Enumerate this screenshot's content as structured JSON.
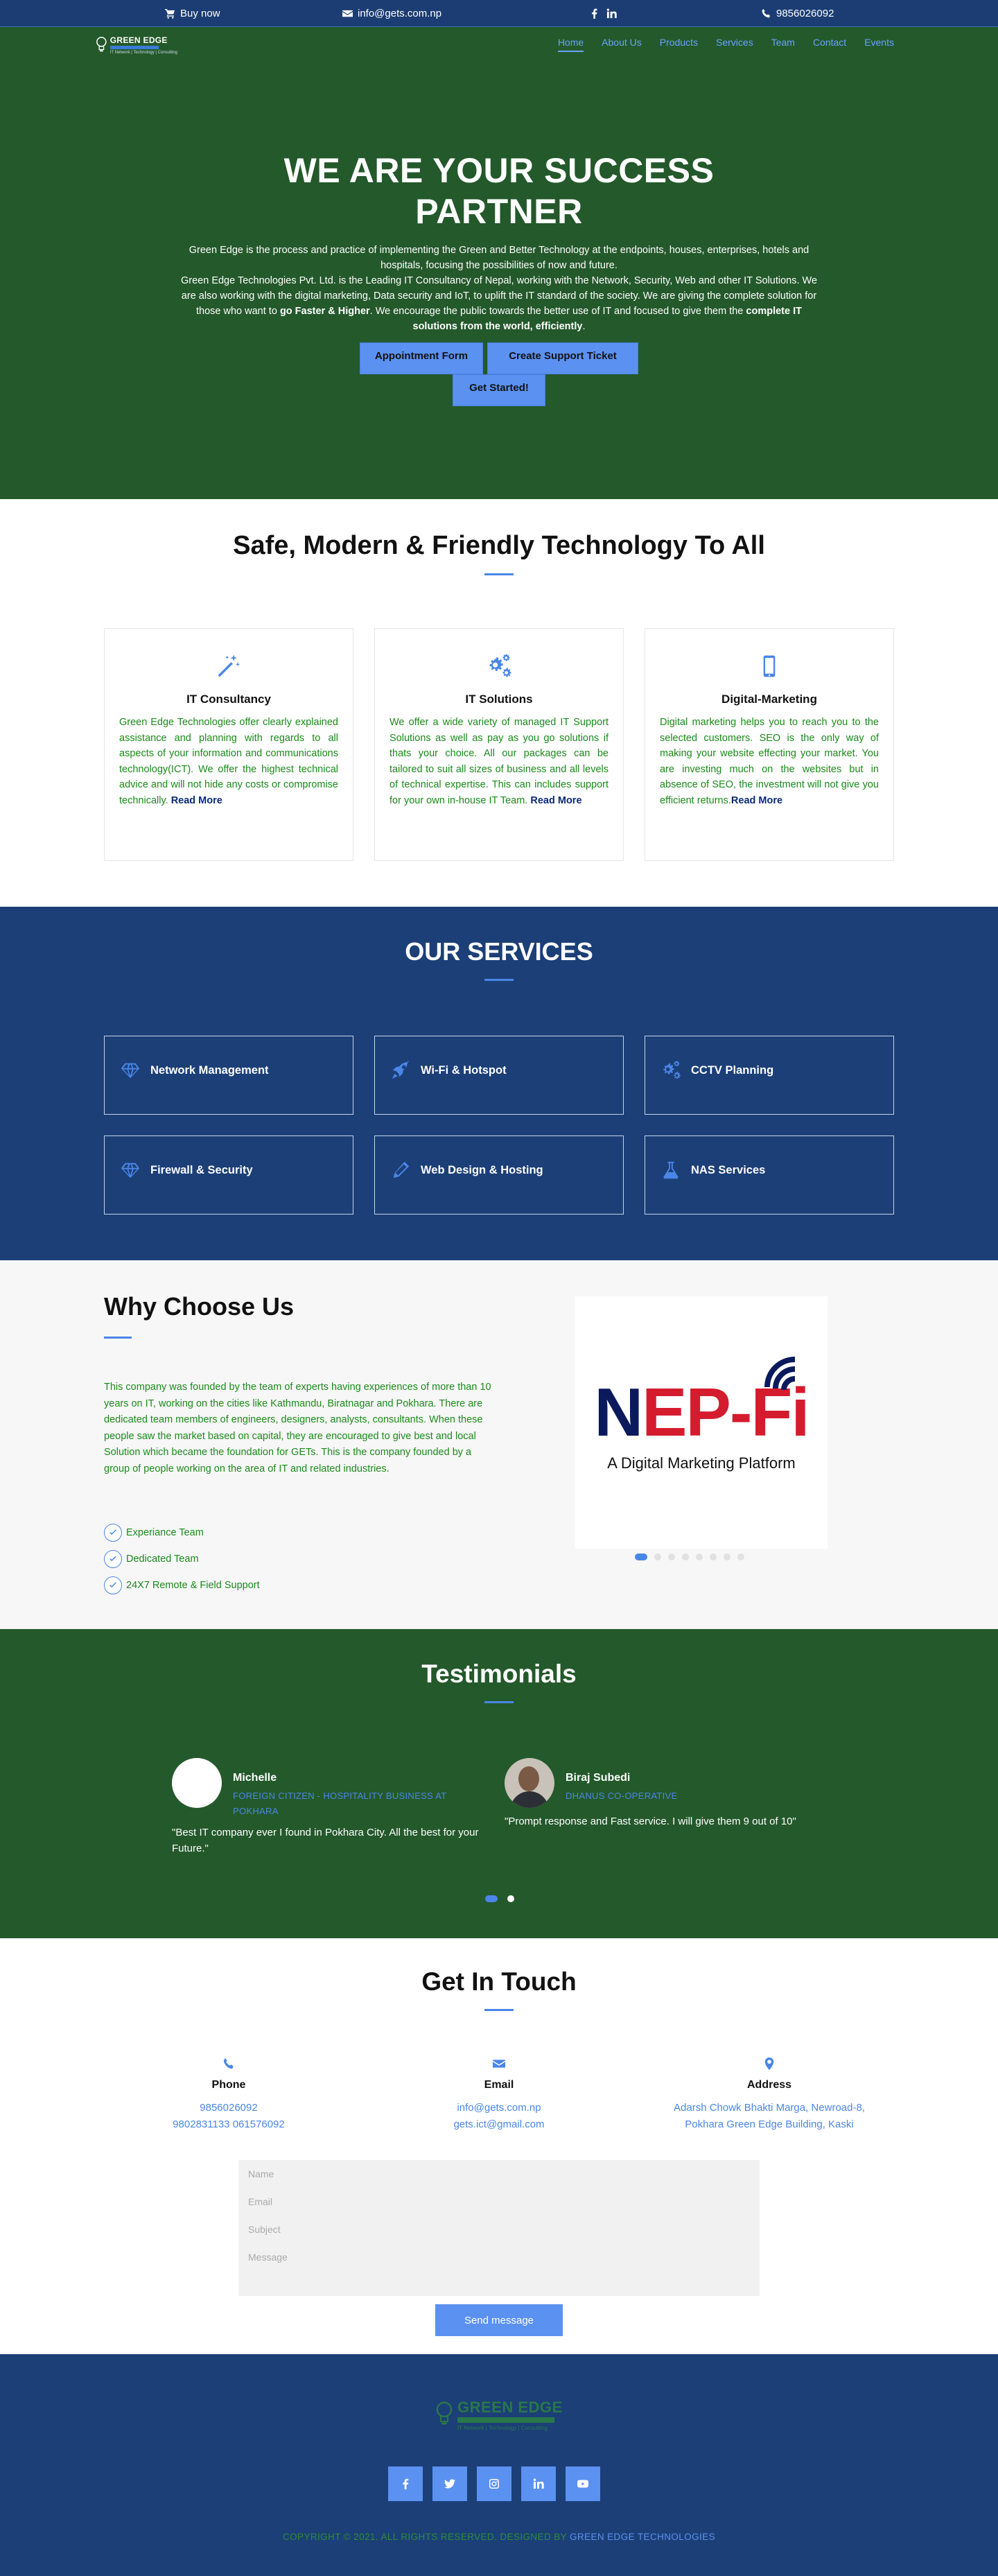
{
  "topbar": {
    "buy": "Buy now",
    "email": "info@gets.com.np",
    "phone": "9856026092"
  },
  "logo": {
    "name": "GREEN EDGE",
    "sub": "IT Network | Technology | Consulting"
  },
  "nav": {
    "items": [
      "Home",
      "About Us",
      "Products",
      "Services",
      "Team",
      "Contact",
      "Events"
    ]
  },
  "hero": {
    "title": "WE ARE YOUR SUCCESS PARTNER",
    "p1": "Green Edge is the process and practice of implementing the Green and Better Technology at the endpoints, houses, enterprises, hotels and hospitals, focusing the possibilities of now and future.",
    "p2a": "Green Edge Technologies Pvt. Ltd. is the Leading IT Consultancy of Nepal, working with the Network, Security, Web and other IT Solutions. We are also working with the digital marketing, Data security and IoT, to uplift the IT standard of the society. We are giving the complete solution for those who want to ",
    "p2b": "go Faster & Higher",
    "p2c": ". We encourage the public towards the better use of IT and focused to give them the ",
    "p2d": "complete IT solutions from the world, efficiently",
    "p2e": ".",
    "btn_appointment": "Appointment Form",
    "btn_support": "Create Support Ticket",
    "btn_start": "Get Started!"
  },
  "safe": {
    "title": "Safe, Modern & Friendly Technology To All",
    "cards": [
      {
        "icon": "magic-wand-icon",
        "title": "IT Consultancy",
        "text": "Green Edge Technologies offer clearly explained assistance and planning with regards to all aspects of your information and communications technology(ICT). We offer the highest technical advice and will not hide any costs or compromise technically. ",
        "more": "Read More"
      },
      {
        "icon": "gears-icon",
        "title": "IT Solutions",
        "text": "We offer a wide variety of managed IT Support Solutions as well as pay as you go solutions if thats your choice. All our packages can be tailored to suit all sizes of business and all levels of technical expertise. This can includes support for your own in-house IT Team. ",
        "more": "Read More"
      },
      {
        "icon": "mobile-icon",
        "title": "Digital-Marketing",
        "text": "Digital marketing helps you to reach you to the selected customers. SEO is the only way of making your website effecting your market. You are investing much on the websites but in absence of SEO, the investment will not give you efficient returns.",
        "more": "Read More"
      }
    ]
  },
  "services": {
    "title": "OUR SERVICES",
    "items": [
      {
        "label": "Network Management",
        "icon": "diamond-icon"
      },
      {
        "label": "Wi-Fi & Hotspot",
        "icon": "rocket-icon"
      },
      {
        "label": "CCTV Planning",
        "icon": "gears-icon"
      },
      {
        "label": "Firewall & Security",
        "icon": "diamond-icon"
      },
      {
        "label": "Web Design & Hosting",
        "icon": "pencil-icon"
      },
      {
        "label": "NAS Services",
        "icon": "flask-icon"
      }
    ]
  },
  "why": {
    "title": "Why Choose Us",
    "text": "This company was founded by the team of experts having experiences of more than 10 years on IT, working on the cities like Kathmandu, Biratnagar and Pokhara. There are dedicated team members of engineers, designers, analysts, consultants. When these people saw the market based on capital, they are encouraged to give best and local Solution which became the foundation for GETs. This is the company founded by a group of people working on the area of IT and related industries.",
    "points": [
      "Experiance Team",
      "Dedicated Team",
      "24X7 Remote & Field Support"
    ],
    "slide_logo_a": "N",
    "slide_logo_b": "E",
    "slide_logo_c": "P-Fi",
    "slide_caption": "A Digital Marketing Platform"
  },
  "testimonials": {
    "title": "Testimonials",
    "items": [
      {
        "name": "Michelle",
        "role": "FOREIGN CITIZEN - HOSPITALITY BUSINESS AT POKHARA",
        "quote": "\"Best IT company ever I found in Pokhara City. All the best for your Future.\""
      },
      {
        "name": "Biraj Subedi",
        "role": "DHANUS CO-OPERATIVE",
        "quote": "\"Prompt response and Fast service. I will give them 9 out of 10\""
      }
    ]
  },
  "contact": {
    "title": "Get In Touch",
    "phone": {
      "label": "Phone",
      "v1": "9856026092",
      "v2": "9802831133 061576092"
    },
    "email": {
      "label": "Email",
      "v1": "info@gets.com.np",
      "v2": "gets.ict@gmail.com"
    },
    "address": {
      "label": "Address",
      "v1": "Adarsh Chowk Bhakti Marga, Newroad-8, Pokhara Green Edge Building, Kaski"
    },
    "form": {
      "name": "Name",
      "email": "Email",
      "subject": "Subject",
      "message": "Message",
      "send": "Send message"
    }
  },
  "footer": {
    "logo_name": "GREEN EDGE",
    "logo_sub": "IT Network | Technology | Consulting",
    "copyright": "COPYRIGHT © 2021. ALL RIGHTS RESERVED. DESIGNED BY ",
    "brand": "GREEN EDGE TECHNOLOGIES"
  },
  "colors": {
    "topbar": "#1b3d73",
    "hero_green": "#24592b",
    "services_blue": "#1c3f77",
    "accent": "#4a86e8",
    "button": "#5b91f0"
  }
}
